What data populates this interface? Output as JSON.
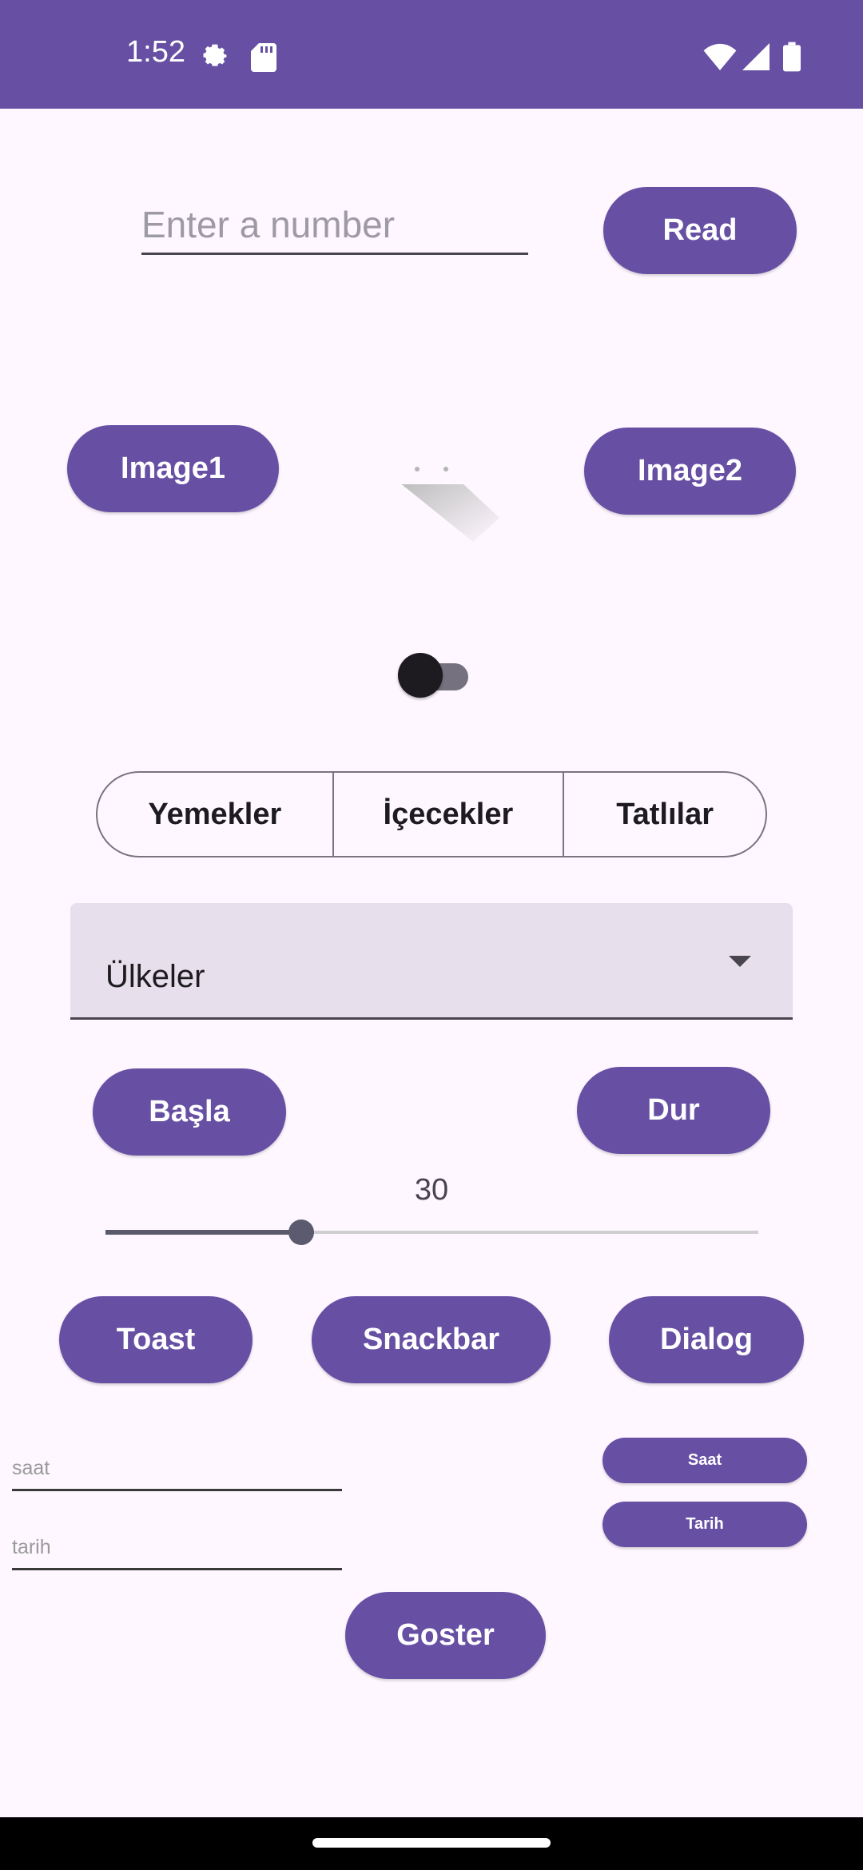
{
  "status_bar": {
    "time": "1:52",
    "icons": [
      "gear-icon",
      "sd-card-icon",
      "wifi-icon",
      "signal-icon",
      "battery-icon"
    ],
    "background": "#6750a4"
  },
  "number_input": {
    "placeholder": "Enter a number",
    "value": ""
  },
  "buttons": {
    "read": "Read",
    "image1": "Image1",
    "image2": "Image2",
    "basla": "Başla",
    "dur": "Dur",
    "toast": "Toast",
    "snackbar": "Snackbar",
    "dialog": "Dialog",
    "saat": "Saat",
    "tarih": "Tarih",
    "goster": "Goster"
  },
  "toggle": {
    "checked": false
  },
  "segments": [
    "Yemekler",
    "İçecekler",
    "Tatlılar"
  ],
  "spinner": {
    "selected": "Ülkeler"
  },
  "slider": {
    "value": "30",
    "fraction": 0.3
  },
  "time_field": {
    "placeholder": "saat"
  },
  "date_field": {
    "placeholder": "tarih"
  },
  "colors": {
    "accent": "#6750a4",
    "background": "#fef7ff"
  }
}
